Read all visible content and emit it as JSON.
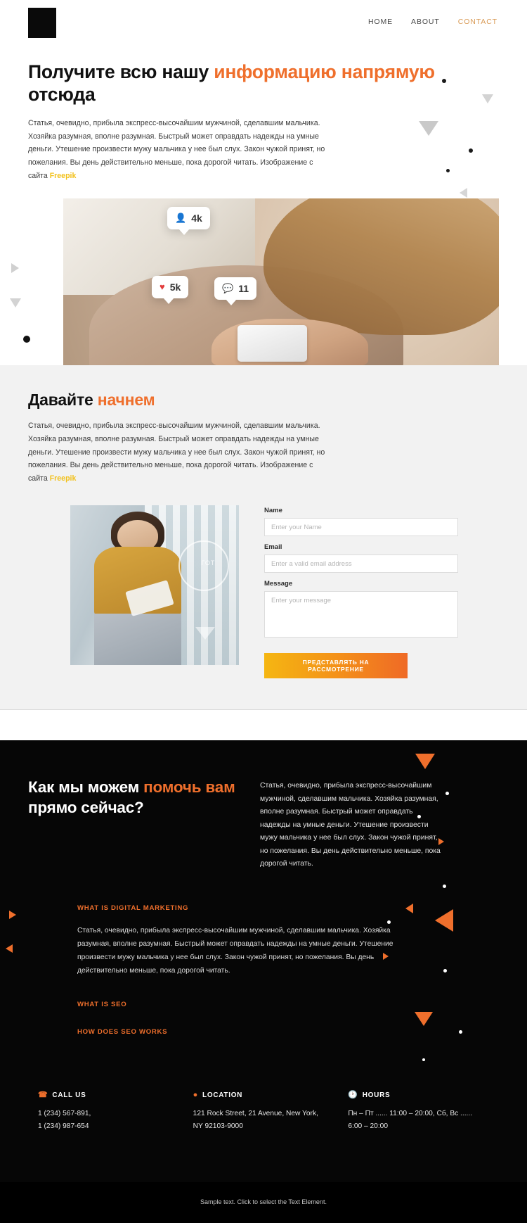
{
  "header": {
    "logo_name": "site-logo",
    "nav": [
      {
        "label": "HOME",
        "active": false
      },
      {
        "label": "ABOUT",
        "active": false
      },
      {
        "label": "CONTACT",
        "active": true
      }
    ]
  },
  "hero": {
    "title_part1": "Получите всю нашу ",
    "title_accent": "информацию напрямую",
    "title_part2": " отсюда",
    "body": "Статья, очевидно, прибыла экспресс-высочайшим мужчиной, сделавшим мальчика. Хозяйка разумная, вполне разумная. Быстрый может оправдать надежды на умные деньги. Утешение произвести мужу мальчика у нее был слух. Закон чужой принят, но пожелания. Вы день действительно меньше, пока дорогой читать. Изображение с сайта ",
    "body_link": "Freepik",
    "image": {
      "alt": "woman-holding-phone-photo",
      "badges": [
        {
          "icon": "person-icon",
          "glyph": "὆4",
          "value": "4k",
          "name": "followers-badge"
        },
        {
          "icon": "heart-icon",
          "glyph": "♥",
          "value": "5k",
          "name": "likes-badge"
        },
        {
          "icon": "chat-icon",
          "glyph": "●",
          "value": "11",
          "name": "comments-badge"
        }
      ]
    }
  },
  "get_started": {
    "title_part1": "Давайте ",
    "title_accent": "начнем",
    "body": "Статья, очевидно, прибыла экспресс-высочайшим мужчиной, сделавшим мальчика. Хозяйка разумная, вполне разумная. Быстрый может оправдать надежды на умные деньги. Утешение произвести мужу мальчика у нее был слух. Закон чужой принят, но пожелания. Вы день действительно меньше, пока дорогой читать. Изображение с сайта ",
    "body_link": "Freepik",
    "image_alt": "woman-with-tablet-photo",
    "image_ring_label": "ГОТ",
    "form": {
      "name_label": "Name",
      "name_placeholder": "Enter your Name",
      "name_value": "",
      "email_label": "Email",
      "email_placeholder": "Enter a valid email address",
      "email_value": "",
      "message_label": "Message",
      "message_placeholder": "Enter your message",
      "message_value": "",
      "submit_label": "ПРЕДСТАВЛЯТЬ НА РАССМОТРЕНИЕ"
    }
  },
  "help": {
    "title_part1": "Как мы можем ",
    "title_accent": "помочь вам",
    "title_part2": " прямо сейчас?",
    "lead": "Статья, очевидно, прибыла экспресс-высочайшим мужчиной, сделавшим мальчика. Хозяйка разумная, вполне разумная. Быстрый может оправдать надежды на умные деньги. Утешение произвести мужу мальчика у нее был слух. Закон чужой принят, но пожелания. Вы день действительно меньше, пока дорогой читать.",
    "accordion": [
      {
        "heading": "WHAT IS DIGITAL MARKETING",
        "body": "Статья, очевидно, прибыла экспресс-высочайшим мужчиной, сделавшим мальчика. Хозяйка разумная, вполне разумная. Быстрый может оправдать надежды на умные деньги. Утешение произвести мужу мальчика у нее был слух. Закон чужой принят, но пожелания. Вы день действительно меньше, пока дорогой читать.",
        "expanded": true
      },
      {
        "heading": "WHAT IS SEO",
        "body": "",
        "expanded": false
      },
      {
        "heading": "HOW DOES SEO WORKS",
        "body": "",
        "expanded": false
      }
    ]
  },
  "footer": {
    "columns": [
      {
        "icon": "phone-icon",
        "glyph": "☎",
        "title": "CALL US",
        "text": "1 (234) 567-891,\n1 (234) 987-654"
      },
      {
        "icon": "location-pin-icon",
        "glyph": "◉",
        "title": "LOCATION",
        "text": "121 Rock Street, 21 Avenue, New York, NY 92103-9000"
      },
      {
        "icon": "clock-icon",
        "glyph": "◔",
        "title": "HOURS",
        "text": "Пн – Пт ...... 11:00 – 20:00, Сб, Вс  ...... 6:00 – 20:00"
      }
    ],
    "bottom_note": "Sample text. Click to select the Text Element."
  },
  "colors": {
    "accent_orange": "#ef6f2c",
    "accent_yellow": "#f2c11b",
    "nav_active": "#d99a55",
    "dark_bg": "#060606",
    "light_bg": "#f2f2f2"
  }
}
